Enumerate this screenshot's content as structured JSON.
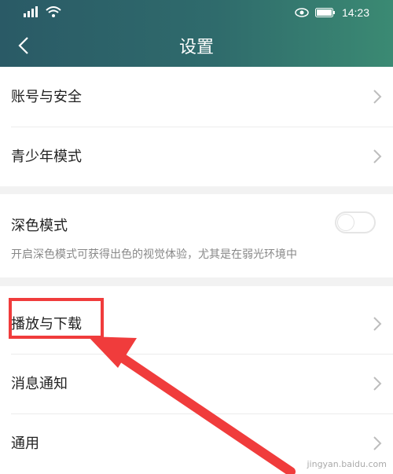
{
  "status_bar": {
    "time": "14:23",
    "icons": [
      "signal-icon",
      "wifi-icon",
      "eye-icon",
      "battery-icon"
    ]
  },
  "header": {
    "title": "设置",
    "back_icon": "chevron-left-icon"
  },
  "sections": [
    {
      "items": [
        {
          "label": "账号与安全"
        },
        {
          "label": "青少年模式"
        }
      ]
    },
    {
      "dark_mode": {
        "label": "深色模式",
        "description": "开启深色模式可获得出色的视觉体验，尤其是在弱光环境中",
        "enabled": false
      }
    },
    {
      "items": [
        {
          "label": "播放与下载"
        },
        {
          "label": "消息通知"
        },
        {
          "label": "通用"
        }
      ]
    }
  ],
  "annotation": {
    "highlight_color": "#f03c3c"
  },
  "watermark": "jingyan.baidu.com"
}
